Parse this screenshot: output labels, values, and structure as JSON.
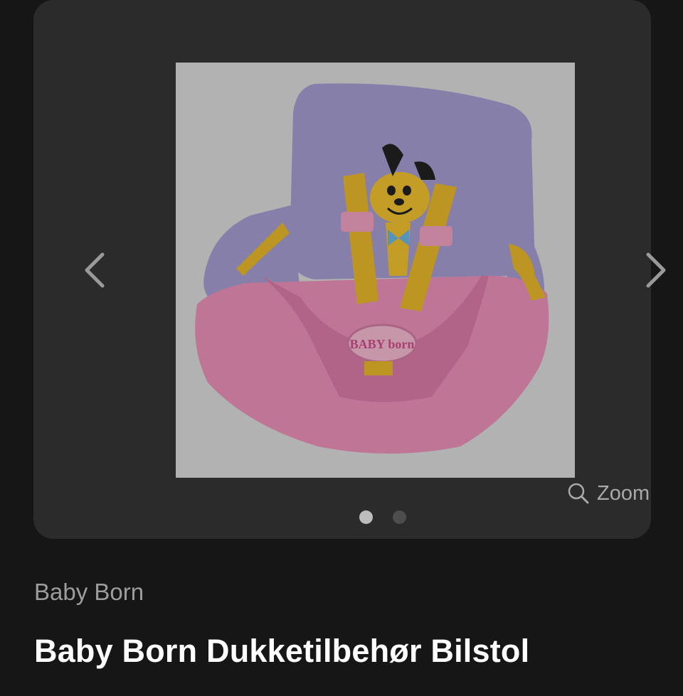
{
  "gallery": {
    "image_alt": "Baby Born car seat doll accessory",
    "image_logo_text": "BABY born",
    "prev_icon": "chevron-left-icon",
    "next_icon": "chevron-right-icon",
    "zoom_icon": "magnifier-icon",
    "zoom_label": "Zoom",
    "current_slide": 1,
    "total_slides": 2
  },
  "product": {
    "brand": "Baby Born",
    "title": "Baby Born Dukketilbehør Bilstol"
  },
  "colors": {
    "background": "#161616",
    "card": "#2b2b2b",
    "seat_lilac": "#a49bd0",
    "seat_pink": "#e98fb8",
    "straps_yellow": "#e6b62a",
    "dot_active": "#bdbdbd",
    "dot_inactive": "#4d4d4d"
  }
}
